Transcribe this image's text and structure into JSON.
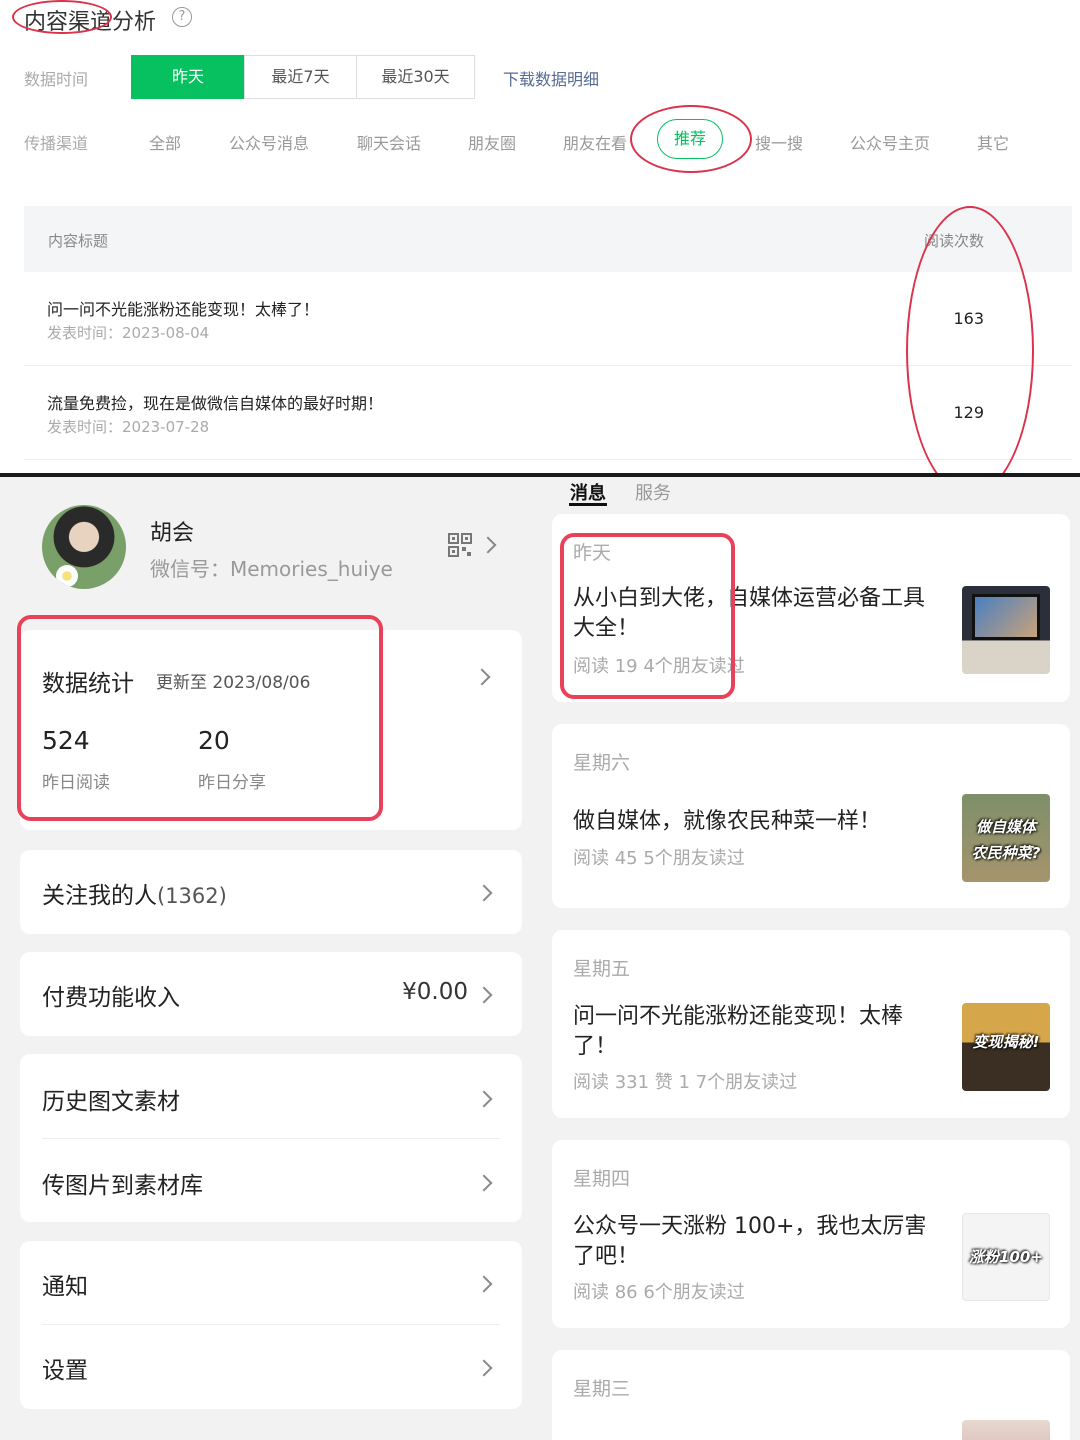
{
  "analytics": {
    "title": "内容渠道分析",
    "help_glyph": "?",
    "time_label": "数据时间",
    "time_ranges": [
      "昨天",
      "最近7天",
      "最近30天"
    ],
    "download_label": "下载数据明细",
    "channel_label": "传播渠道",
    "channels": [
      "全部",
      "公众号消息",
      "聊天会话",
      "朋友圈",
      "朋友在看",
      "推荐",
      "搜一搜",
      "公众号主页",
      "其它"
    ],
    "active_channel": "推荐",
    "table": {
      "col_title": "内容标题",
      "col_reads": "阅读次数",
      "rows": [
        {
          "title": "问一问不光能涨粉还能变现！太棒了！",
          "date": "发表时间：2023-08-04",
          "reads": "163"
        },
        {
          "title": "流量免费捡，现在是做微信自媒体的最好时期！",
          "date": "发表时间：2023-07-28",
          "reads": "129"
        }
      ]
    }
  },
  "profile": {
    "name": "胡会",
    "wechat_id": "微信号：Memories_huiye",
    "stats": {
      "title": "数据统计",
      "updated": "更新至 2023/08/06",
      "reads_value": "524",
      "reads_label": "昨日阅读",
      "shares_value": "20",
      "shares_label": "昨日分享"
    },
    "menu": {
      "followers_label": "关注我的人",
      "followers_count": "(1362)",
      "income_label": "付费功能收入",
      "income_value": "¥0.00",
      "history_label": "历史图文素材",
      "upload_label": "传图片到素材库",
      "notify_label": "通知",
      "settings_label": "设置"
    }
  },
  "messages": {
    "tabs": [
      "消息",
      "服务"
    ],
    "items": [
      {
        "day": "昨天",
        "title": "从小白到大佬，自媒体运营必备工具大全！",
        "meta": "阅读 19   4个朋友读过",
        "thumb_text": ""
      },
      {
        "day": "星期六",
        "title": "做自媒体，就像农民种菜一样！",
        "meta": "阅读 45   5个朋友读过",
        "thumb_text": "做自媒体\n农民种菜?"
      },
      {
        "day": "星期五",
        "title": "问一问不光能涨粉还能变现！太棒了！",
        "meta": "阅读 331   赞 1   7个朋友读过",
        "thumb_text": "变现揭秘!"
      },
      {
        "day": "星期四",
        "title": "公众号一天涨粉 100+，我也太厉害了吧！",
        "meta": "阅读 86   6个朋友读过",
        "thumb_text": "涨粉100+"
      },
      {
        "day": "星期三",
        "title": "",
        "meta": "",
        "thumb_text": ""
      }
    ]
  },
  "colors": {
    "accent": "#07c160",
    "highlight": "#e8425a",
    "link": "#576b95"
  }
}
